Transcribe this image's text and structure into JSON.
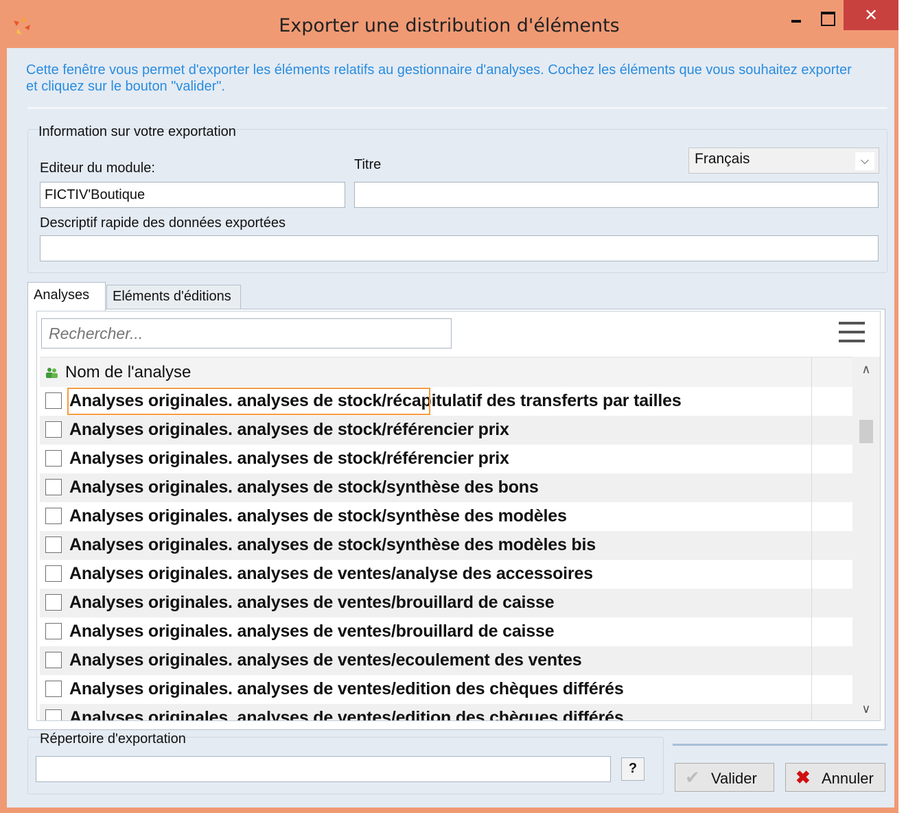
{
  "window": {
    "title": "Exporter une distribution d'éléments",
    "controls": {
      "minimize": "minimize",
      "maximize": "maximize",
      "close": "✕"
    }
  },
  "intro_text": "Cette fenêtre vous permet d'exporter les éléments relatifs au gestionnaire d'analyses. Cochez les éléments que vous souhaitez exporter et cliquez sur le bouton \"valider\".",
  "export_info": {
    "group_label": "Information sur votre exportation",
    "editor_label": "Editeur du module:",
    "editor_value": "FICTIV'Boutique",
    "title_label": "Titre",
    "title_value": "",
    "description_label": "Descriptif rapide des données exportées",
    "description_value": "",
    "language_selected": "Français"
  },
  "tabs": [
    {
      "label": "Analyses",
      "active": true
    },
    {
      "label": "Eléments d'éditions",
      "active": false
    }
  ],
  "grid": {
    "search_placeholder": "Rechercher...",
    "column_header": "Nom de l'analyse",
    "rows": [
      "Analyses originales. analyses de stock/récapitulatif des transferts par tailles",
      "Analyses originales. analyses de stock/référencier prix",
      "Analyses originales. analyses de stock/référencier prix",
      "Analyses originales. analyses de stock/synthèse des bons",
      "Analyses originales. analyses de stock/synthèse des modèles",
      "Analyses originales. analyses de stock/synthèse des modèles bis",
      "Analyses originales. analyses de ventes/analyse des accessoires",
      "Analyses originales. analyses de ventes/brouillard de caisse",
      "Analyses originales. analyses de ventes/brouillard de caisse",
      "Analyses originales. analyses de ventes/ecoulement des ventes",
      "Analyses originales. analyses de ventes/edition des chèques différés",
      "Analyses originales. analyses de ventes/edition des chèques différés"
    ]
  },
  "export_dir": {
    "label": "Répertoire d'exportation",
    "value": "",
    "help_button": "?"
  },
  "buttons": {
    "valider": "Valider",
    "annuler": "Annuler"
  },
  "colors": {
    "title_bar": "#f09a74",
    "close_button": "#c9413f",
    "intro_text": "#2a8cdf",
    "focus_rect": "#f39b3f"
  }
}
